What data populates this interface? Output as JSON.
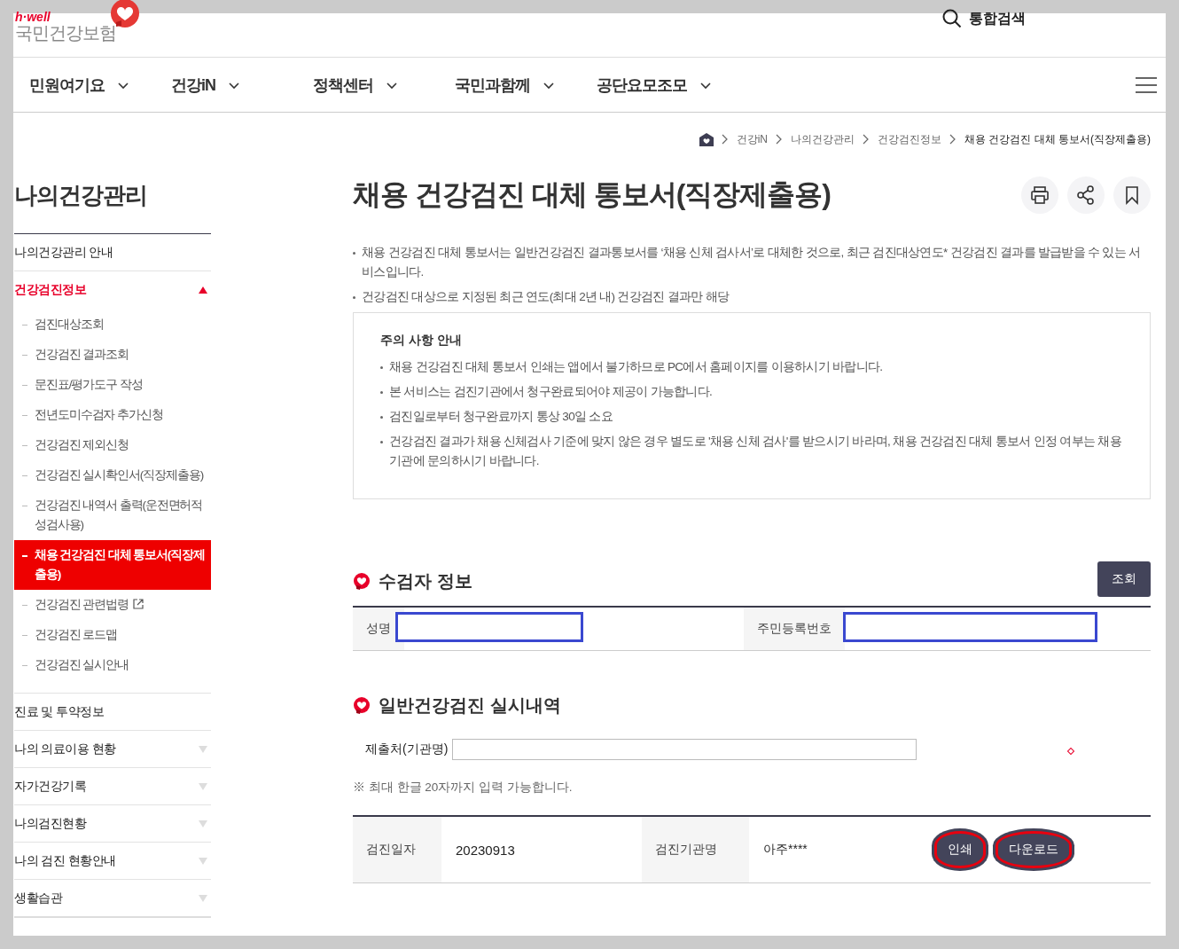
{
  "header": {
    "logo_tagline": "h·well",
    "logo_name": "국민건강보험",
    "search_label": "통합검색"
  },
  "nav": [
    {
      "label": "민원여기요"
    },
    {
      "label": "건강iN"
    },
    {
      "label": "정책센터"
    },
    {
      "label": "국민과함께"
    },
    {
      "label": "공단요모조모"
    }
  ],
  "breadcrumb": [
    "건강iN",
    "나의건강관리",
    "건강검진정보",
    "채용 건강검진 대체 통보서(직장제출용)"
  ],
  "sidebar": {
    "title": "나의건강관리",
    "items": [
      {
        "label": "나의건강관리 안내",
        "selected": false
      },
      {
        "label": "건강검진정보",
        "selected": true,
        "expanded": true,
        "children": [
          {
            "label": "검진대상조회",
            "selected": false
          },
          {
            "label": "건강검진 결과조회",
            "selected": false
          },
          {
            "label": "문진표/평가도구 작성",
            "selected": false
          },
          {
            "label": "전년도미수검자 추가신청",
            "selected": false
          },
          {
            "label": "건강검진 제외신청",
            "selected": false
          },
          {
            "label": "건강검진 실시확인서(직장제출용)",
            "selected": false
          },
          {
            "label": "건강검진 내역서 출력(운전면허적성검사용)",
            "selected": false
          },
          {
            "label": "채용 건강검진 대체 통보서(직장제출용)",
            "selected": true
          },
          {
            "label": "건강검진 관련법령",
            "selected": false,
            "external": true
          },
          {
            "label": "건강검진 로드맵",
            "selected": false
          },
          {
            "label": "건강검진 실시안내",
            "selected": false
          }
        ]
      },
      {
        "label": "진료 및 투약정보",
        "selected": false
      },
      {
        "label": "나의 의료이용 현황",
        "selected": false,
        "expanded": false
      },
      {
        "label": "자가건강기록",
        "selected": false,
        "expanded": false
      },
      {
        "label": "나의검진현황",
        "selected": false,
        "expanded": false
      },
      {
        "label": "나의 검진 현황안내",
        "selected": false,
        "expanded": false
      },
      {
        "label": "생활습관",
        "selected": false,
        "expanded": false
      }
    ]
  },
  "page_title": "채용 건강검진 대체 통보서(직장제출용)",
  "intro": [
    "채용 건강검진 대체 통보서는 일반건강검진 결과통보서를 ‘채용 신체 검사서’로 대체한 것으로, 최근 검진대상연도* 건강검진 결과를 발급받을 수 있는 서비스입니다.",
    "건강검진 대상으로 지정된 최근 연도(최대 2년 내) 건강검진 결과만 해당"
  ],
  "notice": {
    "title": "주의 사항 안내",
    "items": [
      "채용 건강검진 대체 통보서 인쇄는 앱에서 불가하므로 PC에서 홈페이지를 이용하시기 바랍니다.",
      "본 서비스는 검진기관에서 청구완료되어야 제공이 가능합니다.",
      "검진일로부터 청구완료까지 통상 30일 소요",
      "건강검진 결과가 채용 신체검사 기준에 맞지 않은 경우 별도로 '채용 신체 검사'를 받으시기 바라며, 채용 건강검진 대체 통보서 인정 여부는 채용기관에 문의하시기 바랍니다."
    ]
  },
  "examinee": {
    "title": "수검자 정보",
    "button": "조회",
    "fields": [
      {
        "label": "성명",
        "masked": true
      },
      {
        "label": "주민등록번호",
        "masked": true
      }
    ]
  },
  "history": {
    "title": "일반건강검진 실시내역",
    "input_label": "제출처(기관명)",
    "note": "※ 최대 한글 20자까지 입력 가능합니다.",
    "row": {
      "date_label": "검진일자",
      "date": "20230913",
      "org_label": "검진기관명",
      "org": "아주****"
    },
    "buttons": [
      {
        "label": "인쇄",
        "circled": true
      },
      {
        "label": "다운로드",
        "circled": true
      }
    ]
  }
}
